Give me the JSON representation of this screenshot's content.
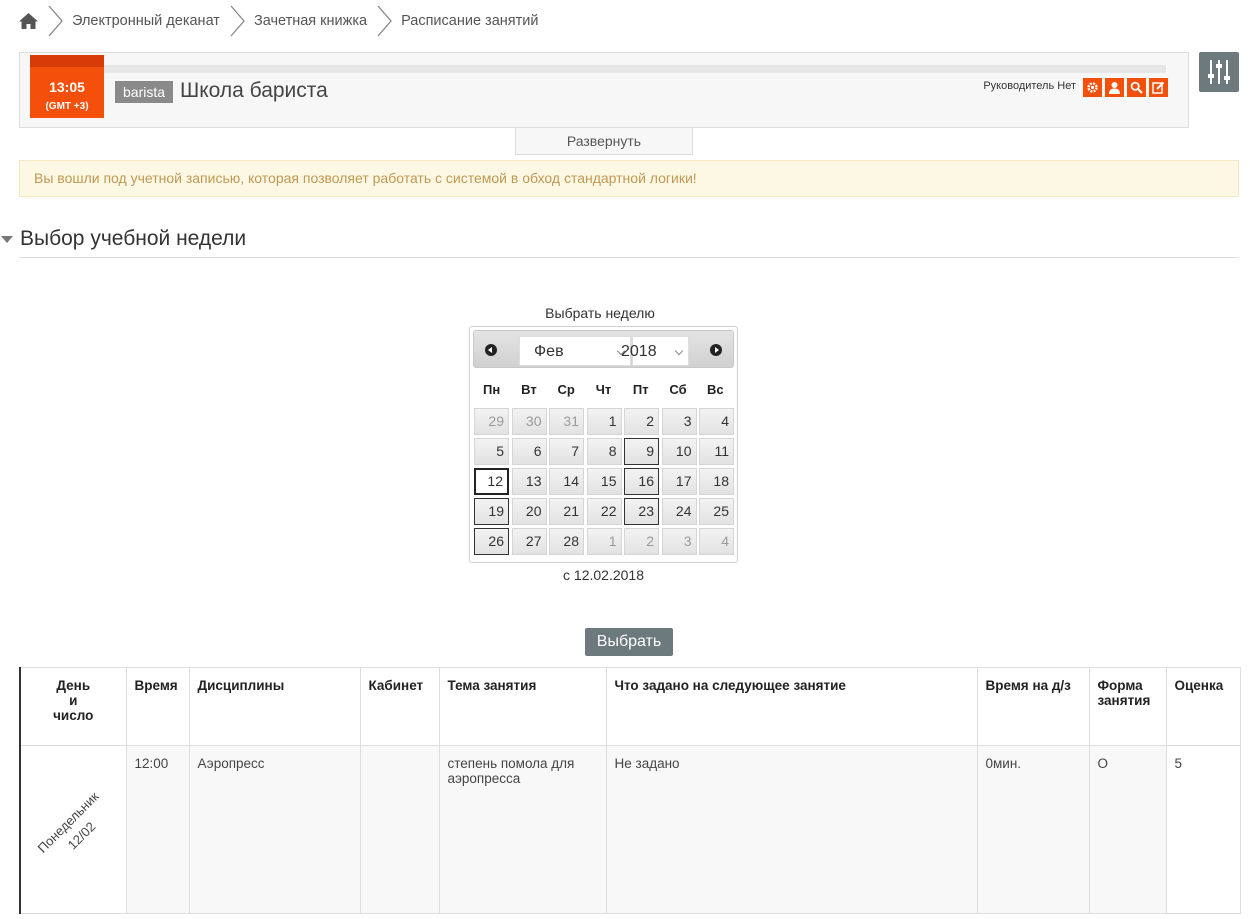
{
  "breadcrumb": {
    "items": [
      "Электронный деканат",
      "Зачетная книжка",
      "Расписание занятий"
    ]
  },
  "header": {
    "time": "13:05",
    "timezone": "(GMT +3)",
    "school_tag": "barista",
    "school_name": "Школа бариста",
    "manager_label": "Руководитель Нет",
    "expand_label": "Развернуть"
  },
  "warning": "Вы вошли под учетной записью, которая позволяет работать с системой в обход стандартной логики!",
  "section": {
    "title": "Выбор учебной недели"
  },
  "calendar": {
    "label": "Выбрать неделю",
    "month": "Фев",
    "year": "2018",
    "weekdays": [
      "Пн",
      "Вт",
      "Ср",
      "Чт",
      "Пт",
      "Сб",
      "Вс"
    ],
    "days": [
      {
        "d": "29",
        "o": true
      },
      {
        "d": "30",
        "o": true
      },
      {
        "d": "31",
        "o": true
      },
      {
        "d": "1"
      },
      {
        "d": "2"
      },
      {
        "d": "3"
      },
      {
        "d": "4"
      },
      {
        "d": "5"
      },
      {
        "d": "6"
      },
      {
        "d": "7"
      },
      {
        "d": "8"
      },
      {
        "d": "9",
        "w": true
      },
      {
        "d": "10"
      },
      {
        "d": "11"
      },
      {
        "d": "12",
        "t": true
      },
      {
        "d": "13"
      },
      {
        "d": "14"
      },
      {
        "d": "15"
      },
      {
        "d": "16",
        "w": true
      },
      {
        "d": "17"
      },
      {
        "d": "18"
      },
      {
        "d": "19",
        "w": true
      },
      {
        "d": "20"
      },
      {
        "d": "21"
      },
      {
        "d": "22"
      },
      {
        "d": "23",
        "w": true
      },
      {
        "d": "24"
      },
      {
        "d": "25"
      },
      {
        "d": "26",
        "w": true
      },
      {
        "d": "27"
      },
      {
        "d": "28"
      },
      {
        "d": "1",
        "o": true
      },
      {
        "d": "2",
        "o": true
      },
      {
        "d": "3",
        "o": true
      },
      {
        "d": "4",
        "o": true
      }
    ],
    "caption": "с 12.02.2018"
  },
  "choose_button": "Выбрать",
  "table": {
    "headers": {
      "day": "День\nи\nчисло",
      "time": "Время",
      "discipline": "Дисциплины",
      "room": "Кабинет",
      "topic": "Тема занятия",
      "homework": "Что задано на следующее занятие",
      "hw_time": "Время на д/з",
      "form": "Форма занятия",
      "grade": "Оценка"
    },
    "rows": [
      {
        "day": "Понедельник\n12/02",
        "time": "12:00",
        "discipline": "Аэропресс",
        "room": "",
        "topic": "степень помола для аэропресса",
        "homework": "Не задано",
        "hw_time": "0мин.",
        "form": "О",
        "grade": "5"
      }
    ]
  },
  "colors": {
    "accent": "#f4500b",
    "button_gray": "#6d7a7d",
    "warning_bg": "#fcf8e3",
    "warning_text": "#c09853"
  }
}
